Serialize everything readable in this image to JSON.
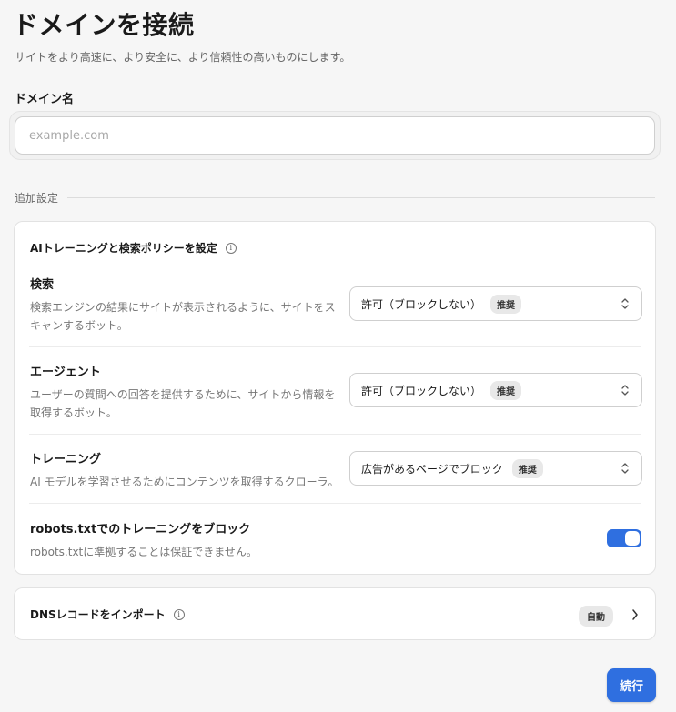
{
  "header": {
    "title": "ドメインを接続",
    "subtitle": "サイトをより高速に、より安全に、より信頼性の高いものにします。"
  },
  "domain": {
    "label": "ドメイン名",
    "placeholder": "example.com",
    "value": ""
  },
  "additional": {
    "section_label": "追加設定"
  },
  "ai_policy": {
    "title": "AIトレーニングと検索ポリシーを設定",
    "info_icon": "info-icon",
    "rows": [
      {
        "name": "検索",
        "desc": "検索エンジンの結果にサイトが表示されるように、サイトをスキャンするボット。",
        "select_value": "許可（ブロックしない）",
        "badge": "推奨"
      },
      {
        "name": "エージェント",
        "desc": "ユーザーの質問への回答を提供するために、サイトから情報を取得するボット。",
        "select_value": "許可（ブロックしない）",
        "badge": "推奨"
      },
      {
        "name": "トレーニング",
        "desc": "AI モデルを学習させるためにコンテンツを取得するクローラ。",
        "select_value": "広告があるページでブロック",
        "badge": "推奨"
      }
    ],
    "robots": {
      "name": "robots.txtでのトレーニングをブロック",
      "desc": "robots.txtに準拠することは保証できません。",
      "enabled": true
    }
  },
  "dns": {
    "title": "DNSレコードをインポート",
    "badge": "自動",
    "chevron_icon": "chevron-right-icon"
  },
  "footer": {
    "continue_label": "続行"
  },
  "colors": {
    "accent": "#2f6fe0",
    "background": "#f6f6f6",
    "card": "#ffffff",
    "badge_bg": "#e8e8e8"
  }
}
